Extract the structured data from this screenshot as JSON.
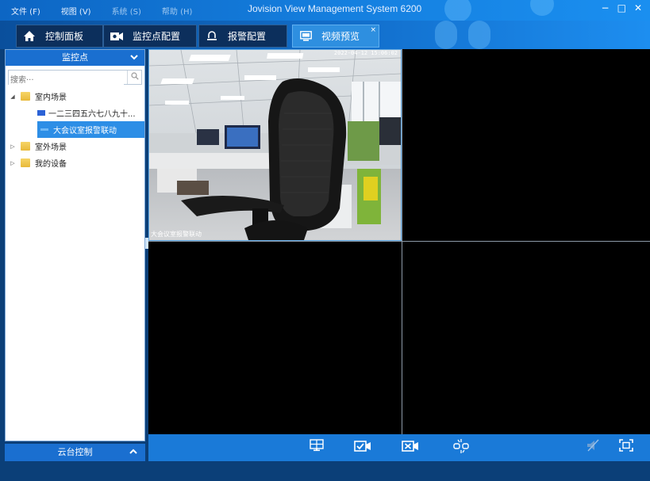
{
  "menu": [
    "文件 (F)",
    "视图 (V)",
    "系统 (S)",
    "帮助 (H)"
  ],
  "app_title": "Jovision View Management System 6200",
  "window_controls": {
    "minimize": "−",
    "maximize": "□",
    "close": "✕"
  },
  "tabs": [
    {
      "label": "控制面板",
      "icon": "home-icon"
    },
    {
      "label": "监控点配置",
      "icon": "camera-config-icon"
    },
    {
      "label": "报警配置",
      "icon": "alarm-bell-icon"
    },
    {
      "label": "视频预览",
      "icon": "video-preview-icon",
      "active": true,
      "close": "×"
    }
  ],
  "sidebar": {
    "title": "监控点",
    "search_placeholder": "搜索···",
    "tree": [
      {
        "label": "室内场景",
        "expanded": true
      },
      {
        "label": "一二三四五六七八九十..."
      },
      {
        "label": "大会议室报警联动",
        "selected": true
      },
      {
        "label": "室外场景",
        "expanded": false
      },
      {
        "label": "我的设备",
        "expanded": false
      }
    ],
    "footer": "云台控制"
  },
  "video": {
    "cell1_timestamp": "2022-04-12 15:06:02",
    "cell1_osd": "大会议室报警联动"
  },
  "colors": {
    "accent": "#1a7ad8",
    "selected": "#2d8ee6",
    "active_tab": "#2e8fe0"
  }
}
